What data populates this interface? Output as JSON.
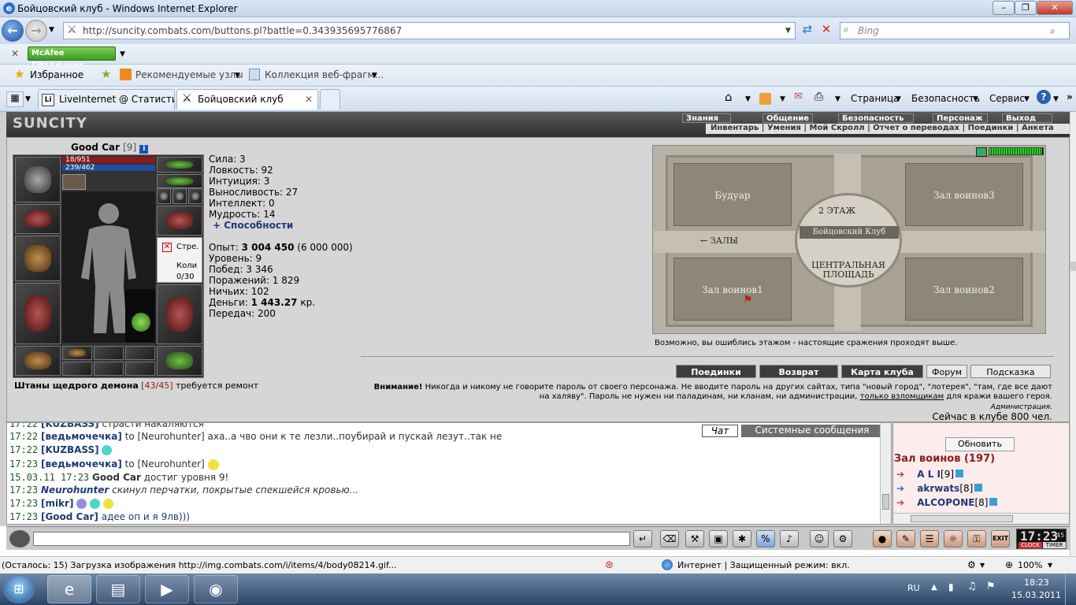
{
  "window": {
    "title": "Бойцовский клуб - Windows Internet Explorer"
  },
  "nav": {
    "url": "http://suncity.combats.com/buttons.pl?battle=0.343935695776867",
    "search_placeholder": "Bing"
  },
  "toolbar": {
    "mcafee": "McAfee SiteAdvisor"
  },
  "favbar": {
    "favorites": "Избранное",
    "recommended": "Рекомендуемые узлы",
    "webslices": "Коллекция веб-фрагм..."
  },
  "tabs": [
    {
      "label": "LiveInternet @ Статистика..."
    },
    {
      "label": "Бойцовский клуб"
    }
  ],
  "commands": {
    "page": "Страница",
    "safety": "Безопасность",
    "service": "Сервис"
  },
  "game": {
    "logo": "SUNCITY",
    "menu_top": [
      "Знания",
      "Общение",
      "Безопасность",
      "Персонаж",
      "Выход"
    ],
    "menu_sub": "Инвентарь | Умения | Мой Скролл | Отчет о переводах | Поединки | Анкета",
    "char": {
      "name": "Good Car",
      "level": "[9]",
      "hp": "18/951",
      "mana": "239/462",
      "buff": "Стре.",
      "buff2": "Коли",
      "buff3": "0/30"
    },
    "stats": [
      {
        "label": "Сила: 3"
      },
      {
        "label": "Ловкость: 92"
      },
      {
        "label": "Интуиция: 3"
      },
      {
        "label": "Выносливость: 27"
      },
      {
        "label": "Интеллект: 0"
      },
      {
        "label": "Мудрость: 14"
      }
    ],
    "abilities": "+ Способности",
    "exp_label": "Опыт:",
    "exp_value": "3 004 450",
    "exp_next": "(6 000 000)",
    "info": [
      {
        "label": "Уровень: 9"
      },
      {
        "label": "Побед: 3 346"
      },
      {
        "label": "Поражений: 1 829"
      },
      {
        "label": "Ничьих: 102"
      }
    ],
    "money_label": "Деньги:",
    "money_value": "1 443.27",
    "money_unit": "кр.",
    "transfers": "Передач: 200",
    "item_note": "Штаны щедрого демона",
    "item_dur": "[43/45]",
    "item_repair": "требуется ремонт",
    "map": {
      "floor": "2 ЭТАЖ",
      "center": "Бойцовский Клуб",
      "halls": "← ЗАЛЫ",
      "plaza": "ЦЕНТРАЛЬНАЯ ПЛОЩАДЬ",
      "rooms": [
        "Будуар",
        "Зал воинов3",
        "Зал воинов1",
        "Зал воинов2"
      ]
    },
    "map_note": "Возможно, вы ошиблись этажом - настоящие сражения проходят выше.",
    "buttons": [
      "Поединки",
      "Возврат",
      "Карта клуба",
      "Форум",
      "Подсказка"
    ],
    "warning_bold": "Внимание!",
    "warning_text": "Никогда и никому не говорите пароль от своего персонажа. Не вводите пароль на других сайтах, типа \"новый город\", \"лотерея\", \"там, где все дают на халяву\". Пароль не нужен ни паладинам, ни кланам, ни администрации,",
    "warning_link": "только взломщикам",
    "warning_end": "для кражи вашего героя.",
    "admin": "Администрация.",
    "online_now": "Сейчас в клубе 800 чел."
  },
  "chat": {
    "tabs": [
      "Чат",
      "Системные сообщения"
    ],
    "lines": [
      {
        "time": "17:22",
        "nick": "[KUZBASS]",
        "text": "страсти накаляются"
      },
      {
        "time": "17:22",
        "nick": "[ведьмочечка]",
        "text": "to [Neurohunter] аха..а чво они к те лезли..поубирай и пускай лезут..так не"
      },
      {
        "time": "17:22",
        "nick": "[KUZBASS]",
        "text": ""
      },
      {
        "time": "17:23",
        "nick": "[ведьмочечка]",
        "text": "to [Neurohunter]"
      },
      {
        "time": "15.03.11 17:23",
        "nick": "Good Car",
        "text": "достиг уровня 9!"
      },
      {
        "time": "17:23",
        "nick": "Neurohunter",
        "text": "скинул перчатки, покрытые спекшейся кровью..."
      },
      {
        "time": "17:23",
        "nick": "[mikr]",
        "text": ""
      },
      {
        "time": "17:23",
        "nick": "[Good Car]",
        "text": "адее оп и я 9лв)))"
      }
    ]
  },
  "online": {
    "refresh": "Обновить",
    "room": "Зал воинов (197)",
    "players": [
      {
        "name": "A L I",
        "lvl": "[9]"
      },
      {
        "name": "akrwats",
        "lvl": "[8]"
      },
      {
        "name": "ALCOPONE",
        "lvl": "[8]"
      }
    ]
  },
  "clock": {
    "time": "17:23",
    "sec": "45",
    "clock_label": "CLOCK",
    "timer_label": "TIMER",
    "exit": "EXIT"
  },
  "status": {
    "text": "(Осталось: 15) Загрузка изображения http://img.combats.com/i/items/4/body08214.gif...",
    "zone": "Интернет | Защищенный режим: вкл.",
    "zoom": "100%"
  },
  "taskbar": {
    "lang": "RU",
    "time": "18:23",
    "date": "15.03.2011"
  }
}
